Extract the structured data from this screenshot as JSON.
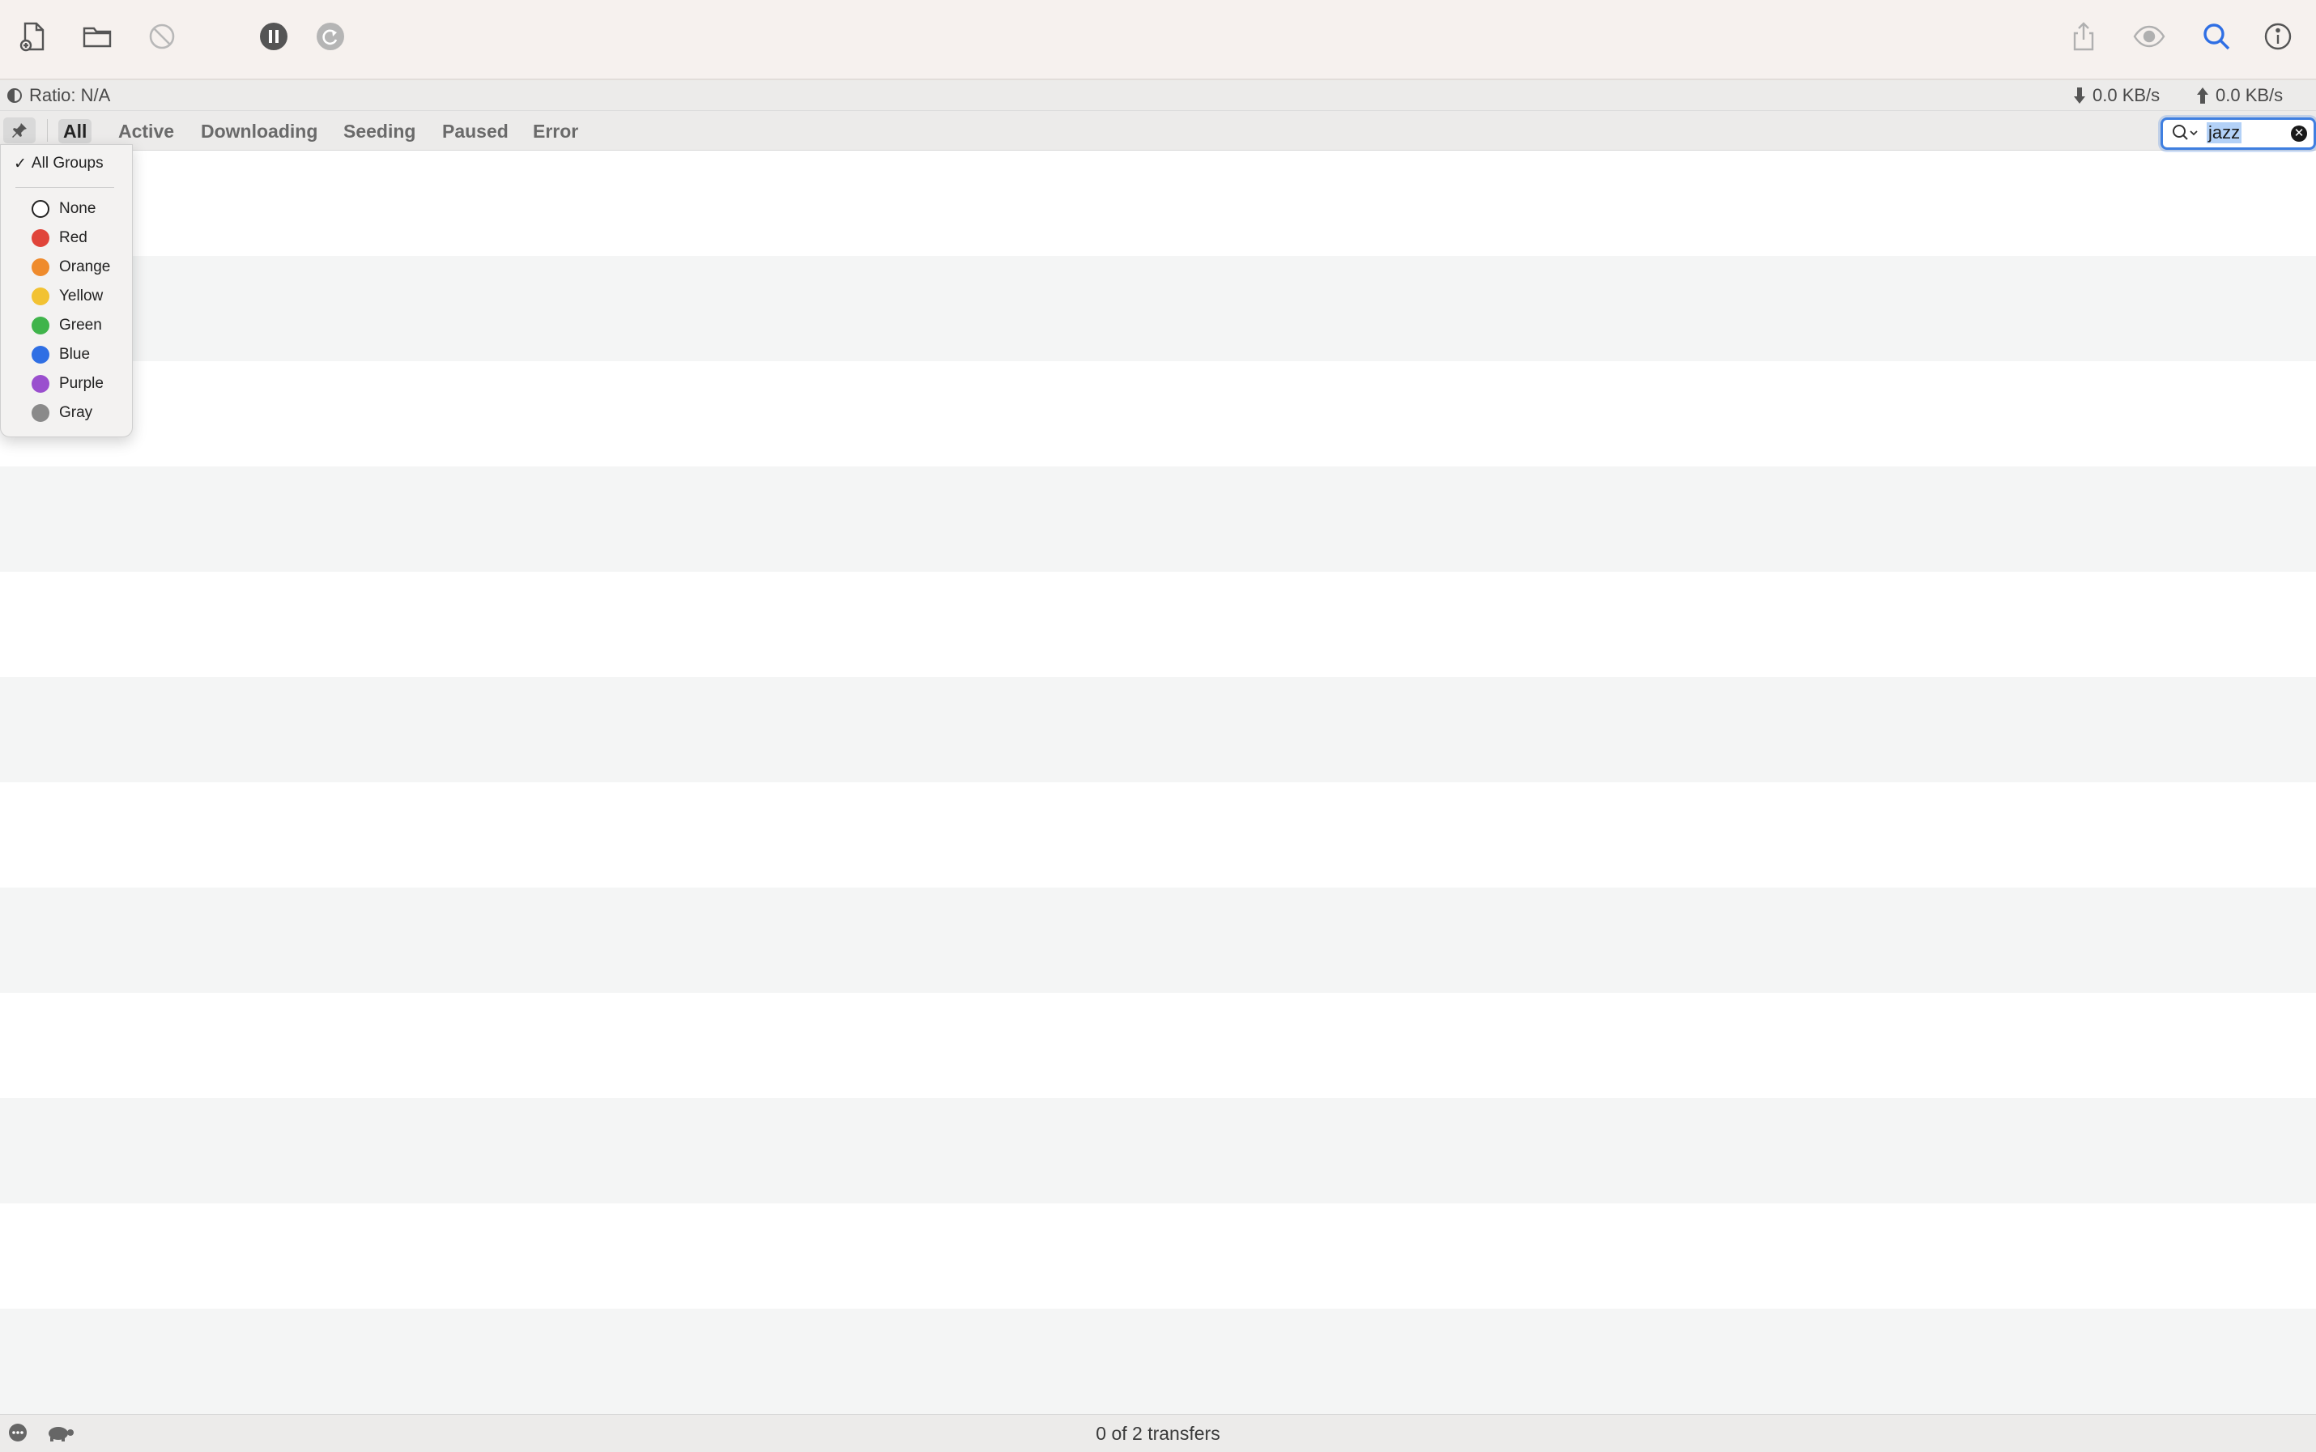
{
  "toolbar": {
    "buttons": [
      {
        "name": "new-document-icon"
      },
      {
        "name": "folder-icon"
      },
      {
        "name": "remove-icon"
      },
      {
        "name": "pause-icon"
      },
      {
        "name": "resume-icon"
      },
      {
        "name": "share-icon"
      },
      {
        "name": "eye-icon"
      },
      {
        "name": "search-icon"
      },
      {
        "name": "info-icon"
      }
    ]
  },
  "status": {
    "ratio": "Ratio: N/A",
    "download_speed": "0.0 KB/s",
    "upload_speed": "0.0 KB/s"
  },
  "filters": {
    "tabs": [
      "All",
      "Active",
      "Downloading",
      "Seeding",
      "Paused",
      "Error"
    ],
    "active": "All"
  },
  "search": {
    "value": "jazz",
    "clear_glyph": "✕"
  },
  "groups_menu": {
    "checkmark": "✓",
    "header": "All Groups",
    "items": [
      {
        "label": "None",
        "color": "none"
      },
      {
        "label": "Red",
        "color": "#e0443a"
      },
      {
        "label": "Orange",
        "color": "#ef8b2c"
      },
      {
        "label": "Yellow",
        "color": "#f2c232"
      },
      {
        "label": "Green",
        "color": "#3fb44b"
      },
      {
        "label": "Blue",
        "color": "#2f6fe4"
      },
      {
        "label": "Purple",
        "color": "#9a4fce"
      },
      {
        "label": "Gray",
        "color": "#8a8a8a"
      }
    ]
  },
  "footer": {
    "transfers": "0 of 2 transfers"
  }
}
